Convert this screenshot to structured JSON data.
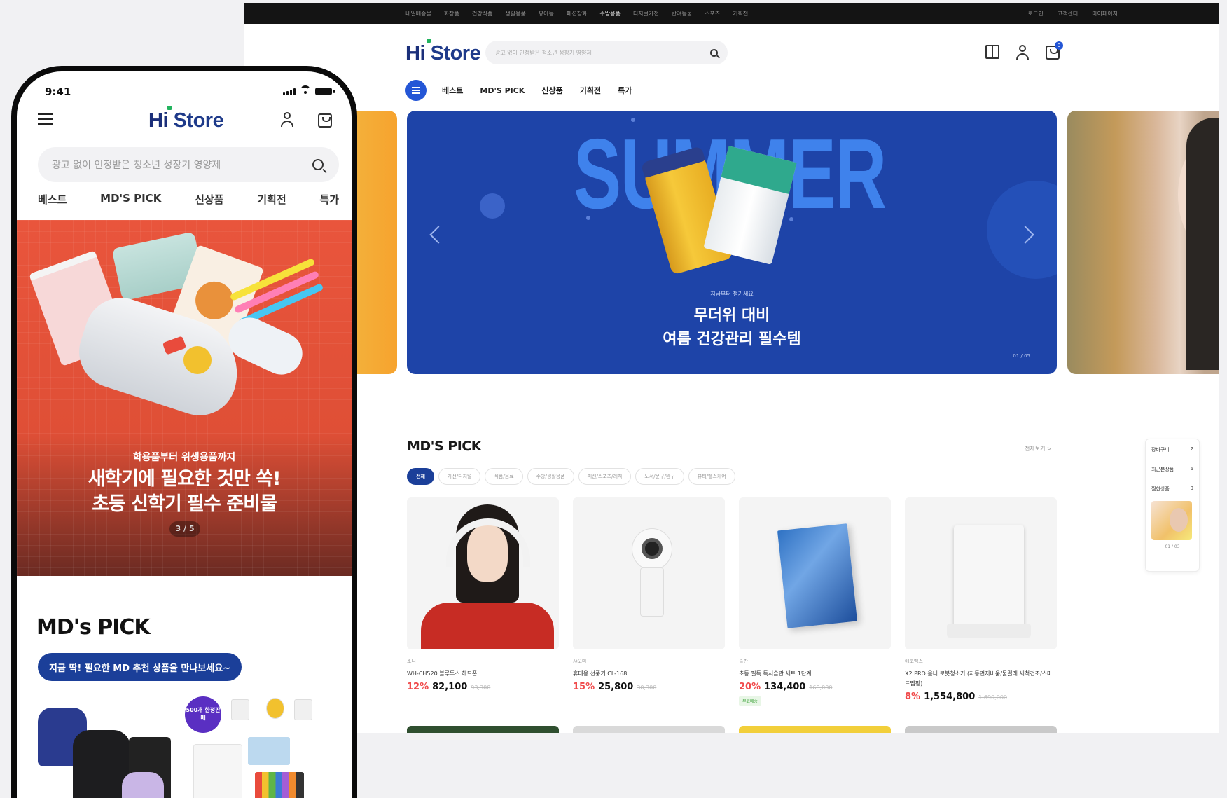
{
  "brand": {
    "hi": "Hi",
    "store": "Store",
    "flag_color": "#22b35e",
    "primary_color": "#1b3f99"
  },
  "desktop": {
    "util_links": [
      "내일배송몰",
      "화장품",
      "건강식품",
      "생활용품",
      "유아동",
      "패션잡화",
      "주방용품",
      "디지털가전",
      "반려동물",
      "스포츠",
      "기획전",
      "이벤트"
    ],
    "util_right": [
      "로그인",
      "고객센터",
      "마이페이지"
    ],
    "search_placeholder": "광고 없이 인정받은 청소년 성장기 영양제",
    "cart_count": "0",
    "nav": [
      "베스트",
      "MD'S PICK",
      "신상품",
      "기획전",
      "특가"
    ],
    "hero": {
      "word": "SUMMER",
      "eyebrow": "지금부터 챙기세요",
      "title_line1": "무더위 대비",
      "title_line2": "여름 건강관리 필수템",
      "pager": "01 / 05"
    },
    "mds": {
      "title": "MD'S PICK",
      "more": "전체보기 >",
      "chips": [
        "전체",
        "가전/디지털",
        "식품/음료",
        "주방/생활용품",
        "패션/스포츠/레저",
        "도서/문구/완구",
        "뷰티/헬스케어"
      ],
      "products": [
        {
          "brand": "소니",
          "name": "WH-CH520 블루투스 헤드폰",
          "discount": "12%",
          "price": "82,100",
          "original": "93,300",
          "tag": ""
        },
        {
          "brand": "샤오미",
          "name": "휴대용 선풍기 CL-168",
          "discount": "15%",
          "price": "25,800",
          "original": "30,300",
          "tag": ""
        },
        {
          "brand": "출판",
          "name": "초등 필독 독서습관 세트 1단계",
          "discount": "20%",
          "price": "134,400",
          "original": "168,000",
          "tag": "무료배송"
        },
        {
          "brand": "에코백스",
          "name": "X2 PRO 옴니 로봇청소기 (자동먼지비움/물걸레 세척건조/스마트맵핑)",
          "discount": "8%",
          "price": "1,554,800",
          "original": "1,690,000",
          "tag": ""
        }
      ]
    },
    "recent": {
      "rows": [
        {
          "label": "장바구니",
          "count": "2"
        },
        {
          "label": "최근본상품",
          "count": "6"
        },
        {
          "label": "찜한상품",
          "count": "0"
        }
      ],
      "pager": "01 / 03"
    }
  },
  "phone": {
    "time": "9:41",
    "search_placeholder": "광고 없이 인정받은 청소년 성장기 영양제",
    "tabs": [
      "베스트",
      "MD'S PICK",
      "신상품",
      "기획전",
      "특가"
    ],
    "banner": {
      "eyebrow": "학용품부터 위생용품까지",
      "title_line1": "새학기에 필요한 것만 쏙!",
      "title_line2": "초등 신학기 필수 준비물",
      "pager": "3 / 5"
    },
    "mds": {
      "title": "MD's PICK",
      "button": "지금 딱! 필요한 MD 추천 상품을 만나보세요~",
      "badge": "500개 한정판매"
    }
  }
}
